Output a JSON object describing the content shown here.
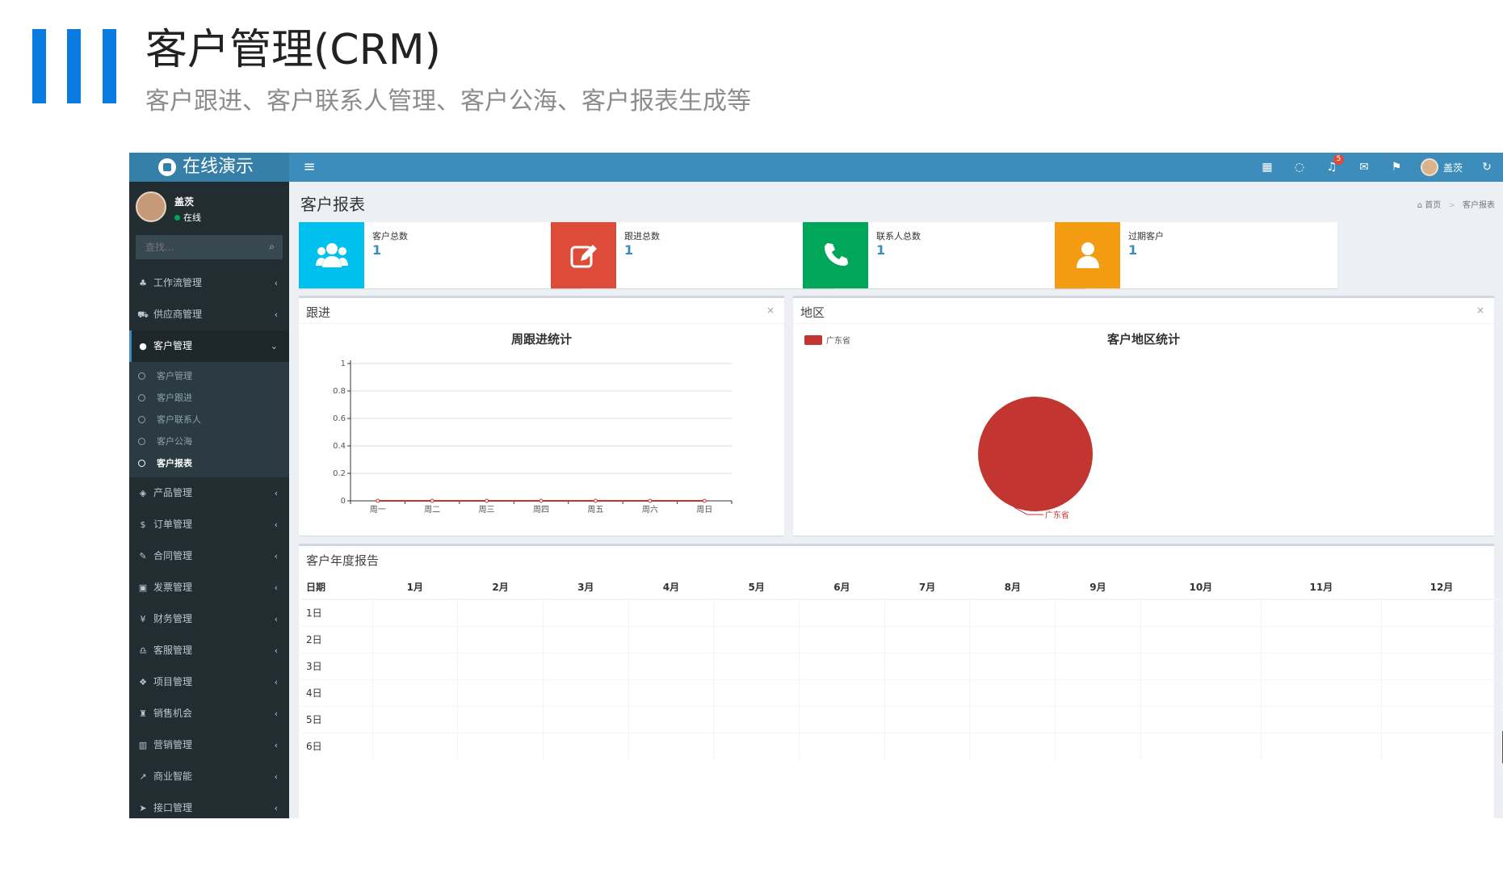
{
  "slide": {
    "title": "客户管理(CRM)",
    "subtitle": "客户跟进、客户联系人管理、客户公海、客户报表生成等"
  },
  "topbar": {
    "brand": "在线演示",
    "menu_toggle": "≡",
    "notification_count": "5",
    "user_name": "盖茨"
  },
  "sidebar": {
    "user": {
      "name": "盖茨",
      "status": "在线"
    },
    "search": {
      "placeholder": "查找..."
    },
    "items": [
      {
        "label": "工作流管理",
        "icon": "sitemap-icon"
      },
      {
        "label": "供应商管理",
        "icon": "truck-icon"
      },
      {
        "label": "客户管理",
        "icon": "user-icon",
        "active": true
      },
      {
        "label": "产品管理",
        "icon": "cube-icon"
      },
      {
        "label": "订单管理",
        "icon": "dollar-icon"
      },
      {
        "label": "合同管理",
        "icon": "pencil-icon"
      },
      {
        "label": "发票管理",
        "icon": "money-icon"
      },
      {
        "label": "财务管理",
        "icon": "yen-icon"
      },
      {
        "label": "客服管理",
        "icon": "headset-icon"
      },
      {
        "label": "项目管理",
        "icon": "cubes-icon"
      },
      {
        "label": "销售机会",
        "icon": "binoculars-icon"
      },
      {
        "label": "营销管理",
        "icon": "bar-chart-icon"
      },
      {
        "label": "商业智能",
        "icon": "line-chart-icon"
      },
      {
        "label": "接口管理",
        "icon": "send-icon"
      }
    ],
    "submenu": [
      {
        "label": "客户管理"
      },
      {
        "label": "客户跟进"
      },
      {
        "label": "客户联系人"
      },
      {
        "label": "客户公海"
      },
      {
        "label": "客户报表",
        "active": true
      }
    ]
  },
  "content": {
    "title": "客户报表",
    "breadcrumb": {
      "home": "首页",
      "current": "客户报表"
    }
  },
  "info_boxes": [
    {
      "label": "客户总数",
      "value": "1",
      "color": "#00c0ef",
      "icon": "users-icon"
    },
    {
      "label": "跟进总数",
      "value": "1",
      "color": "#dd4b39",
      "icon": "edit-icon"
    },
    {
      "label": "联系人总数",
      "value": "1",
      "color": "#00a65a",
      "icon": "phone-icon"
    },
    {
      "label": "过期客户",
      "value": "1",
      "color": "#f39c12",
      "icon": "user-icon"
    }
  ],
  "panels": {
    "followup": {
      "title": "跟进",
      "close": "×"
    },
    "region": {
      "title": "地区",
      "close": "×"
    },
    "annual": {
      "title": "客户年度报告"
    }
  },
  "chart_data": [
    {
      "type": "line",
      "title": "周跟进统计",
      "categories": [
        "周一",
        "周二",
        "周三",
        "周四",
        "周五",
        "周六",
        "周日"
      ],
      "series": [
        {
          "values": [
            0,
            0,
            0,
            0,
            0,
            0,
            0
          ],
          "color": "#c23531"
        }
      ],
      "ylim": [
        0,
        1
      ],
      "yticks": [
        0,
        0.2,
        0.4,
        0.6,
        0.8,
        1
      ],
      "grid": true
    },
    {
      "type": "pie",
      "title": "客户地区统计",
      "legend": "top-left",
      "slices": [
        {
          "label": "广东省",
          "value": 1,
          "color": "#c23531"
        }
      ]
    }
  ],
  "annual_table": {
    "headers": [
      "日期",
      "1月",
      "2月",
      "3月",
      "4月",
      "5月",
      "6月",
      "7月",
      "8月",
      "9月",
      "10月",
      "11月",
      "12月"
    ],
    "rows": [
      "1日",
      "2日",
      "3日",
      "4日",
      "5日",
      "6日"
    ]
  }
}
